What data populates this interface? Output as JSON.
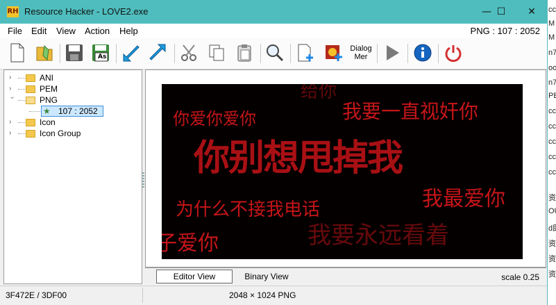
{
  "window": {
    "logo_text": "RH",
    "title": "Resource Hacker - LOVE2.exe",
    "minimize_glyph": "—",
    "maximize_glyph": "☐",
    "close_glyph": "✕"
  },
  "menu": {
    "items": [
      "File",
      "Edit",
      "View",
      "Action",
      "Help"
    ],
    "status": "PNG : 107 : 2052"
  },
  "toolbar": {
    "icons": [
      "new-file-icon",
      "open-file-icon",
      "save-icon",
      "save-as-icon",
      "compile-back-icon",
      "compile-forward-icon",
      "cut-icon",
      "copy-icon",
      "paste-icon",
      "find-icon",
      "add-resource-icon",
      "add-image-icon",
      "dialog-menu-icon",
      "run-icon",
      "info-icon",
      "power-icon"
    ],
    "save_as_label": "As",
    "dialog_menu_label_1": "Dialog",
    "dialog_menu_label_2": "Mer"
  },
  "tree": {
    "items": [
      {
        "label": "ANI",
        "expanded": false
      },
      {
        "label": "PEM",
        "expanded": false
      },
      {
        "label": "PNG",
        "expanded": true
      },
      {
        "label": "107 : 2052",
        "selected": true
      },
      {
        "label": "Icon",
        "expanded": false
      },
      {
        "label": "Icon Group",
        "expanded": false
      }
    ]
  },
  "preview": {
    "lines": [
      "你爱你爱你",
      "我要一直视奸你",
      "你别想甩掉我",
      "我最爱你",
      "为什么不接我电话",
      "我要永远看着",
      "子爱你",
      "给你"
    ]
  },
  "tabs": {
    "editor": "Editor View",
    "binary": "Binary View",
    "scale": "scale 0.25"
  },
  "status": {
    "offset": "3F472E / 3DF00",
    "info": "2048 × 1024  PNG"
  },
  "background_window": {
    "fragments": [
      "cc",
      "M",
      "M",
      "n7",
      "oo",
      "n7",
      "PE",
      "cc",
      "cc",
      "cc",
      "cc",
      "cc",
      "资",
      "OU",
      "d即",
      "资",
      "资",
      "资"
    ]
  },
  "colors": {
    "titlebar": "#4fbdbd",
    "close_red": "#d6001c",
    "selection": "#cce8ff",
    "art_red": "#c41519"
  }
}
